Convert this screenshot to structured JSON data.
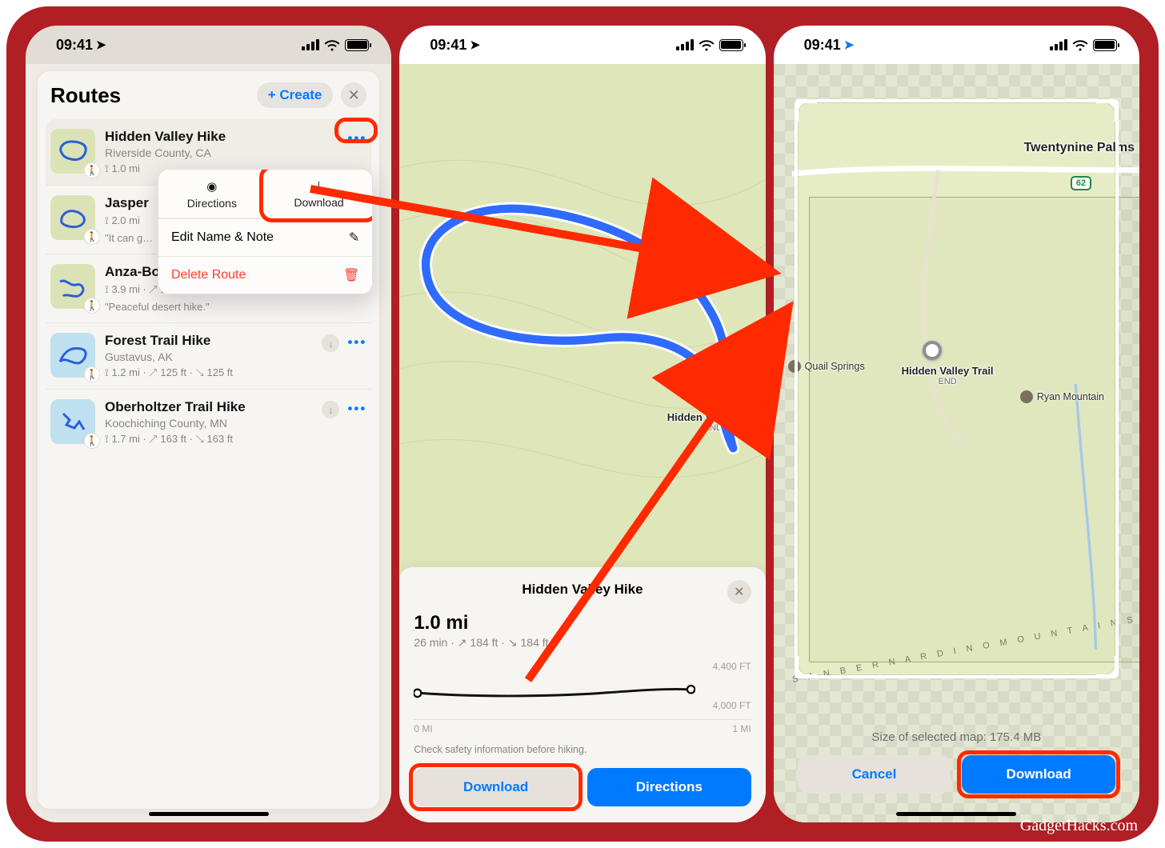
{
  "status": {
    "time": "09:41"
  },
  "phone1": {
    "panel_title": "Routes",
    "create_label": "+ Create",
    "popover": {
      "directions": "Directions",
      "download": "Download",
      "edit": "Edit Name & Note",
      "delete": "Delete Route"
    },
    "routes": [
      {
        "title": "Hidden Valley Hike",
        "subtitle": "Riverside County, CA",
        "meta": "⟟ 1.0 mi"
      },
      {
        "title": "Jasper",
        "subtitle": "",
        "meta": "⟟ 2.0 mi",
        "note": "\"It can g…"
      },
      {
        "title": "Anza-Borrego Hiking Trail",
        "subtitle": "",
        "meta": "⟟ 3.9 mi · ↗ 1,454 ft · ↘ 1,454 ft",
        "note": "\"Peaceful desert hike.\""
      },
      {
        "title": "Forest Trail Hike",
        "subtitle": "Gustavus, AK",
        "meta": "⟟ 1.2 mi · ↗ 125 ft · ↘ 125 ft"
      },
      {
        "title": "Oberholtzer Trail Hike",
        "subtitle": "Koochiching County, MN",
        "meta": "⟟ 1.7 mi · ↗ 163 ft · ↘ 163 ft"
      }
    ]
  },
  "phone2": {
    "sheet_title": "Hidden Valley Hike",
    "distance": "1.0 mi",
    "stats_sub": "26 min · ↗ 184 ft · ↘ 184 ft",
    "elev_top": "4,400 FT",
    "elev_bottom": "4,000 FT",
    "x_start": "0 MI",
    "x_end": "1 MI",
    "safety": "Check safety information before hiking.",
    "download": "Download",
    "directions": "Directions",
    "map_label": "Hidden Valley Trail",
    "map_label_end": "END"
  },
  "phone3": {
    "city_label": "Twentynine Palms",
    "hwy": "62",
    "poi_quail": "Quail Springs",
    "poi_ryan": "Ryan Mountain",
    "trail_label": "Hidden Valley Trail",
    "trail_end": "END",
    "ridge": "S A N   B E R N A R D I N O   M O U N T A I N S",
    "size_label": "Size of selected map: 175.4 MB",
    "cancel": "Cancel",
    "download": "Download"
  },
  "watermark": "GadgetHacks.com"
}
